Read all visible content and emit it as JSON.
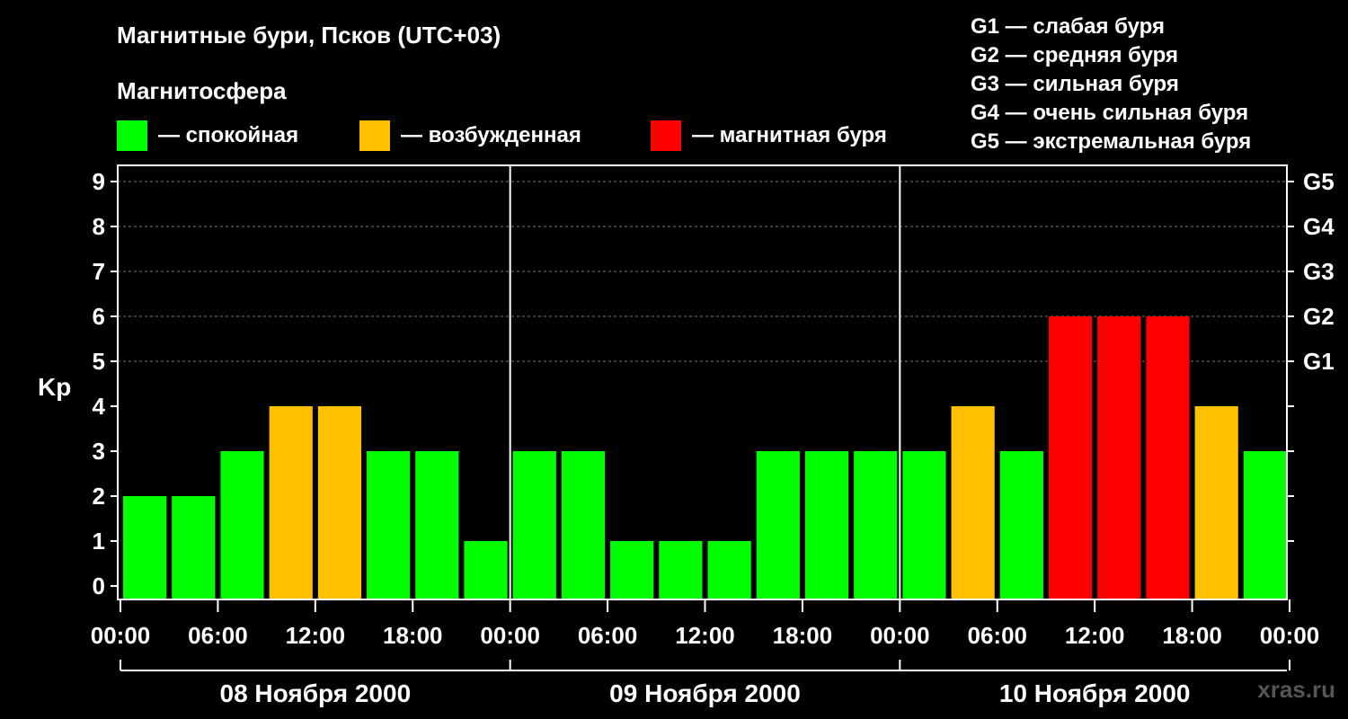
{
  "title": "Магнитные бури, Псков (UTC+03)",
  "subtitle": "Магнитосфера",
  "legend": [
    {
      "label": "— спокойная",
      "color": "#00ff00"
    },
    {
      "label": "— возбужденная",
      "color": "#ffc000"
    },
    {
      "label": "— магнитная буря",
      "color": "#ff0000"
    }
  ],
  "g_legend": [
    "G1 — слабая буря",
    "G2 — средняя буря",
    "G3 — сильная буря",
    "G4 — очень сильная буря",
    "G5 — экстремальная буря"
  ],
  "watermark": "xras.ru",
  "chart_data": {
    "type": "bar",
    "ylabel": "Kp",
    "ylim": [
      0,
      9
    ],
    "yticks": [
      0,
      1,
      2,
      3,
      4,
      5,
      6,
      7,
      8,
      9
    ],
    "right_ticks": [
      {
        "value": 5,
        "label": "G1"
      },
      {
        "value": 6,
        "label": "G2"
      },
      {
        "value": 7,
        "label": "G3"
      },
      {
        "value": 8,
        "label": "G4"
      },
      {
        "value": 9,
        "label": "G5"
      }
    ],
    "grid": true,
    "xtick_labels": [
      "00:00",
      "06:00",
      "12:00",
      "18:00",
      "00:00",
      "06:00",
      "12:00",
      "18:00",
      "00:00",
      "06:00",
      "12:00",
      "18:00",
      "00:00"
    ],
    "days": [
      "08 Ноября 2000",
      "09 Ноября 2000",
      "10 Ноября 2000"
    ],
    "values": [
      2,
      2,
      3,
      4,
      4,
      3,
      3,
      1,
      3,
      3,
      1,
      1,
      1,
      3,
      3,
      3,
      3,
      4,
      3,
      6,
      6,
      6,
      4,
      3
    ],
    "colors": {
      "quiet": "#00ff00",
      "active": "#ffc000",
      "storm": "#ff0000"
    }
  }
}
